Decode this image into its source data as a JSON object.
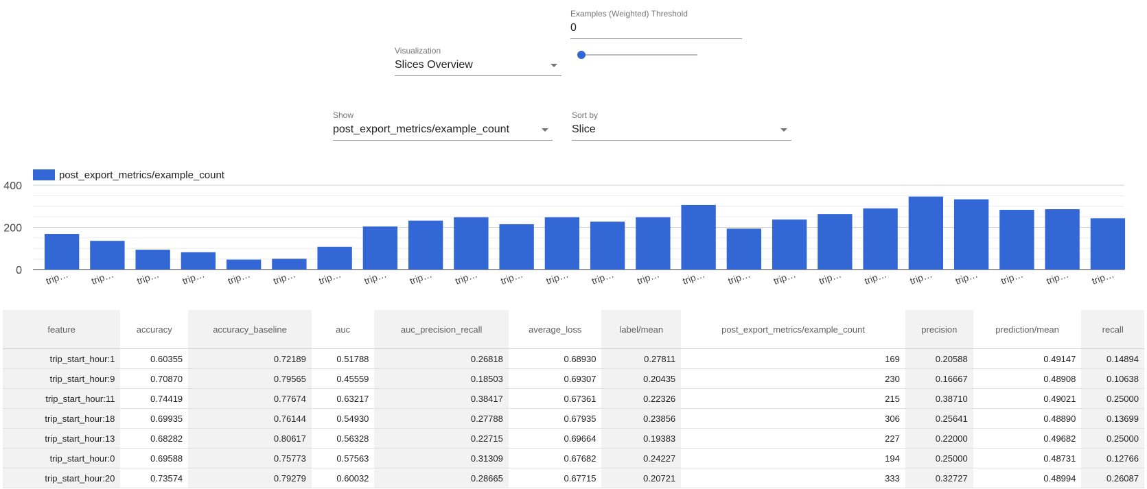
{
  "threshold": {
    "label": "Examples (Weighted) Threshold",
    "value": "0",
    "slider_fraction": 0
  },
  "visualization": {
    "label": "Visualization",
    "value": "Slices Overview"
  },
  "show": {
    "label": "Show",
    "value": "post_export_metrics/example_count"
  },
  "sort_by": {
    "label": "Sort by",
    "value": "Slice"
  },
  "chart_data": {
    "type": "bar",
    "series": [
      {
        "name": "post_export_metrics/example_count",
        "values": [
          169,
          136,
          94,
          82,
          47,
          51,
          108,
          204,
          232,
          248,
          215,
          248,
          227,
          248,
          306,
          194,
          237,
          263,
          290,
          346,
          333,
          283,
          286,
          243
        ]
      }
    ],
    "categories": [
      "trip…",
      "trip…",
      "trip…",
      "trip…",
      "trip…",
      "trip…",
      "trip…",
      "trip…",
      "trip…",
      "trip…",
      "trip…",
      "trip…",
      "trip…",
      "trip…",
      "trip…",
      "trip…",
      "trip…",
      "trip…",
      "trip…",
      "trip…",
      "trip…",
      "trip…",
      "trip…",
      "trip…"
    ],
    "yticks": [
      0,
      200,
      400
    ],
    "ylim": [
      0,
      400
    ],
    "color": "#3367d6"
  },
  "table": {
    "columns": [
      "feature",
      "accuracy",
      "accuracy_baseline",
      "auc",
      "auc_precision_recall",
      "average_loss",
      "label/mean",
      "post_export_metrics/example_count",
      "precision",
      "prediction/mean",
      "recall"
    ],
    "rows": [
      [
        "trip_start_hour:1",
        "0.60355",
        "0.72189",
        "0.51788",
        "0.26818",
        "0.68930",
        "0.27811",
        "169",
        "0.20588",
        "0.49147",
        "0.14894"
      ],
      [
        "trip_start_hour:9",
        "0.70870",
        "0.79565",
        "0.45559",
        "0.18503",
        "0.69307",
        "0.20435",
        "230",
        "0.16667",
        "0.48908",
        "0.10638"
      ],
      [
        "trip_start_hour:11",
        "0.74419",
        "0.77674",
        "0.63217",
        "0.38417",
        "0.67361",
        "0.22326",
        "215",
        "0.38710",
        "0.49021",
        "0.25000"
      ],
      [
        "trip_start_hour:18",
        "0.69935",
        "0.76144",
        "0.54930",
        "0.27788",
        "0.67935",
        "0.23856",
        "306",
        "0.25641",
        "0.48890",
        "0.13699"
      ],
      [
        "trip_start_hour:13",
        "0.68282",
        "0.80617",
        "0.56328",
        "0.22715",
        "0.69664",
        "0.19383",
        "227",
        "0.22000",
        "0.49682",
        "0.25000"
      ],
      [
        "trip_start_hour:0",
        "0.69588",
        "0.75773",
        "0.57563",
        "0.31309",
        "0.67682",
        "0.24227",
        "194",
        "0.25000",
        "0.48731",
        "0.12766"
      ],
      [
        "trip_start_hour:20",
        "0.73574",
        "0.79279",
        "0.60032",
        "0.28665",
        "0.67715",
        "0.20721",
        "333",
        "0.32727",
        "0.48994",
        "0.26087"
      ]
    ]
  }
}
